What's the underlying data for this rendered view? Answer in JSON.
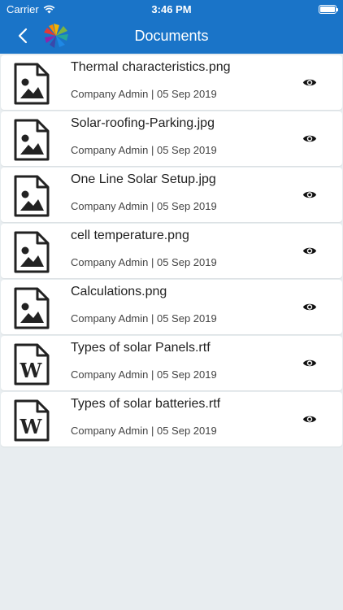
{
  "status_bar": {
    "carrier": "Carrier",
    "time": "3:46 PM"
  },
  "header": {
    "title": "Documents",
    "back_icon": "chevron-left-icon",
    "logo": "pinwheel-logo"
  },
  "colors": {
    "header_bg": "#1a74c8",
    "background": "#e8edf0",
    "icon": "#222222"
  },
  "documents": [
    {
      "name": "Thermal characteristics.png",
      "owner": "Company Admin",
      "date": "05 Sep 2019",
      "meta": "Company Admin | 05 Sep 2019",
      "type": "image"
    },
    {
      "name": "Solar-roofing-Parking.jpg",
      "owner": "Company Admin",
      "date": "05 Sep 2019",
      "meta": "Company Admin | 05 Sep 2019",
      "type": "image"
    },
    {
      "name": "One Line Solar Setup.jpg",
      "owner": "Company Admin",
      "date": "05 Sep 2019",
      "meta": "Company Admin | 05 Sep 2019",
      "type": "image"
    },
    {
      "name": "cell temperature.png",
      "owner": "Company Admin",
      "date": "05 Sep 2019",
      "meta": "Company Admin | 05 Sep 2019",
      "type": "image"
    },
    {
      "name": "Calculations.png",
      "owner": "Company Admin",
      "date": "05 Sep 2019",
      "meta": "Company Admin | 05 Sep 2019",
      "type": "image"
    },
    {
      "name": "Types of solar Panels.rtf",
      "owner": "Company Admin",
      "date": "05 Sep 2019",
      "meta": "Company Admin | 05 Sep 2019",
      "type": "word"
    },
    {
      "name": "Types of solar batteries.rtf",
      "owner": "Company Admin",
      "date": "05 Sep 2019",
      "meta": "Company Admin | 05 Sep 2019",
      "type": "word"
    }
  ]
}
